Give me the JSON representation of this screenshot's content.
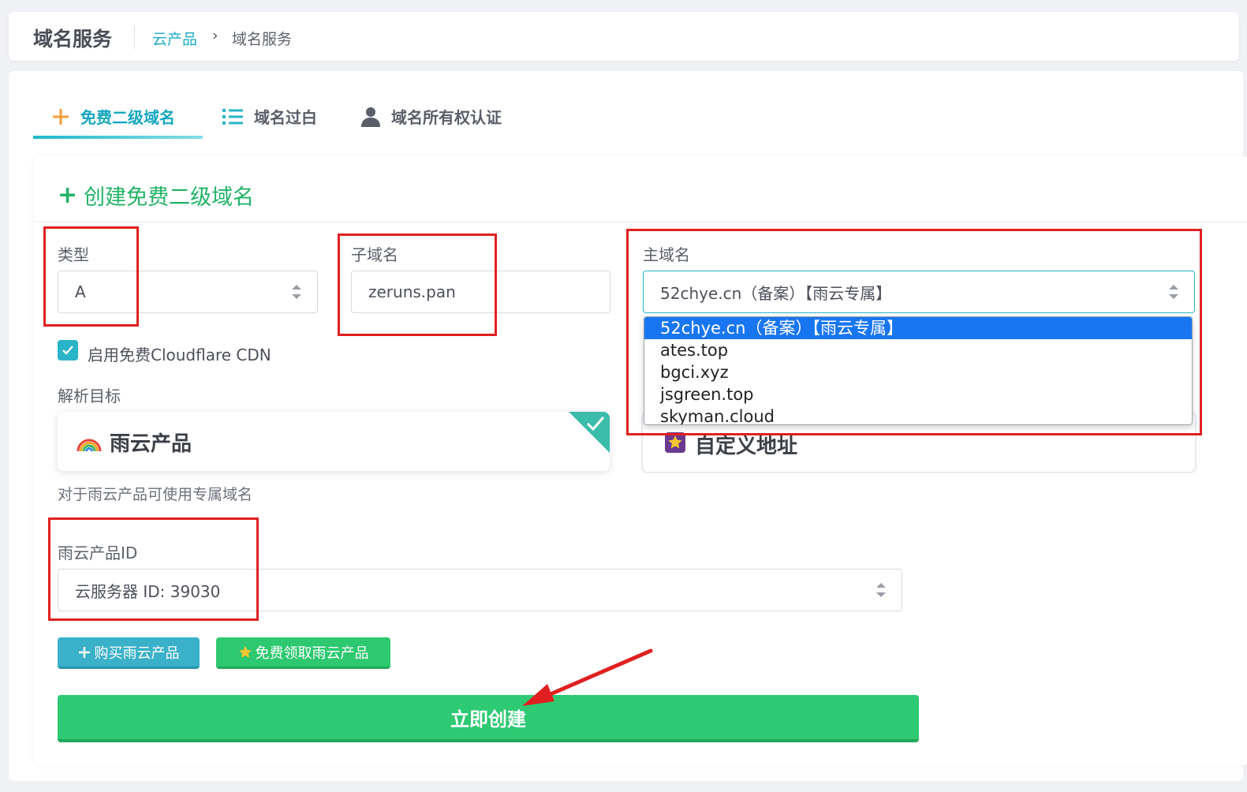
{
  "header": {
    "title": "域名服务",
    "breadcrumb": {
      "link": "云产品",
      "separator": "›",
      "current": "域名服务"
    }
  },
  "tabs": [
    {
      "label": "免费二级域名",
      "icon": "plus-icon",
      "active": true
    },
    {
      "label": "域名过白",
      "icon": "list-icon",
      "active": false
    },
    {
      "label": "域名所有权认证",
      "icon": "user-icon",
      "active": false
    }
  ],
  "form": {
    "title": "创建免费二级域名",
    "type": {
      "label": "类型",
      "value": "A"
    },
    "subdomain": {
      "label": "子域名",
      "value": "zeruns.pan"
    },
    "main_domain": {
      "label": "主域名",
      "value": "52chye.cn（备案）【雨云专属】",
      "options": [
        "52chye.cn（备案）【雨云专属】",
        "ates.top",
        "bgci.xyz",
        "jsgreen.top",
        "skyman.cloud"
      ],
      "selected_index": 0
    },
    "cdn": {
      "label": "启用免费Cloudflare CDN",
      "checked": true
    },
    "target": {
      "label": "解析目标",
      "options": [
        {
          "label": "雨云产品",
          "icon": "rainbow-icon",
          "selected": true
        },
        {
          "label": "自定义地址",
          "icon": "star-icon",
          "selected": false
        }
      ],
      "hint": "对于雨云产品可使用专属域名"
    },
    "product_id": {
      "label": "雨云产品ID",
      "value": "云服务器 ID: 39030"
    },
    "buttons": {
      "buy": "购买雨云产品",
      "free": "免费领取雨云产品",
      "create": "立即创建"
    }
  },
  "colors": {
    "accent": "#16a7bf",
    "green": "#2ec973",
    "annotation_red": "#e02020",
    "dropdown_highlight": "#1976f2"
  }
}
